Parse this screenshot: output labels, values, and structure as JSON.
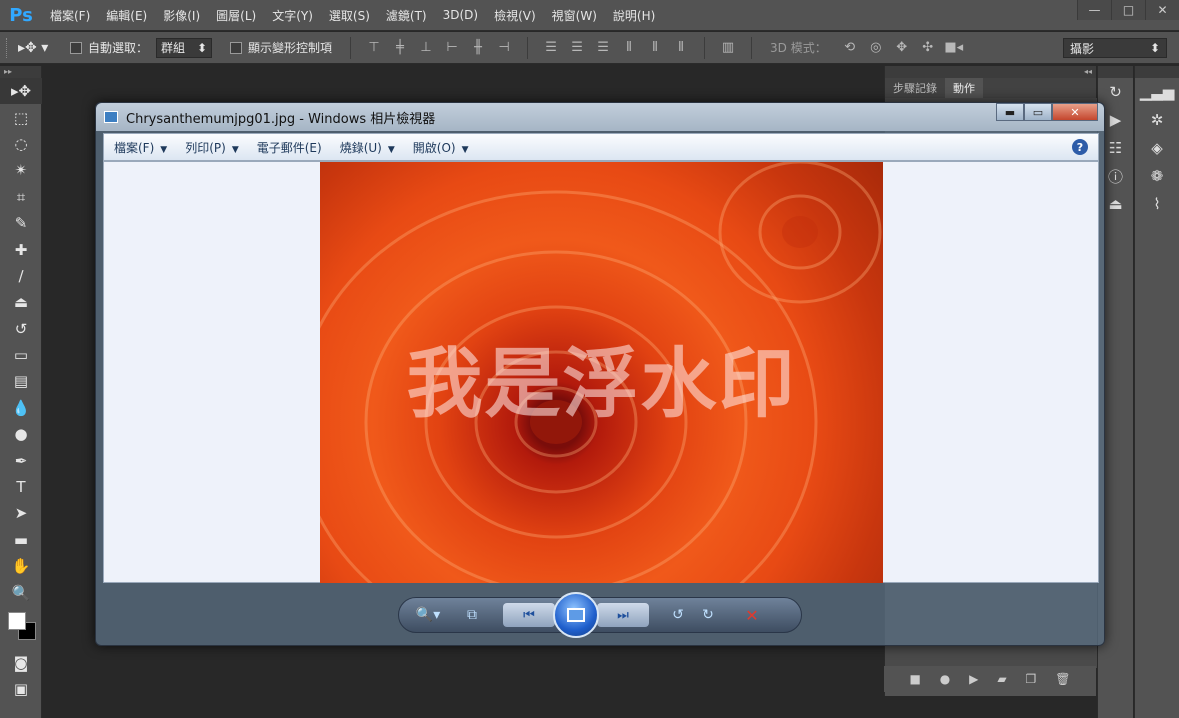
{
  "app": {
    "logo": "Ps",
    "menu": [
      "檔案(F)",
      "編輯(E)",
      "影像(I)",
      "圖層(L)",
      "文字(Y)",
      "選取(S)",
      "濾鏡(T)",
      "3D(D)",
      "檢視(V)",
      "視窗(W)",
      "說明(H)"
    ],
    "window_controls": [
      "—",
      "□",
      "✕"
    ]
  },
  "options_bar": {
    "tool_icon": "move-tool-icon",
    "auto_select_label": "自動選取：",
    "auto_select_value": "群組",
    "show_transform_label": "顯示變形控制項",
    "mode_3d_label": "3D 模式：",
    "workspace_value": "攝影"
  },
  "panels": {
    "tabs": [
      "步驟記錄",
      "動作"
    ],
    "active_tab": "動作"
  },
  "viewer": {
    "title": "Chrysanthemumjpg01.jpg - Windows 相片檢視器",
    "menu": [
      {
        "label": "檔案(F)",
        "has_arrow": true
      },
      {
        "label": "列印(P)",
        "has_arrow": true
      },
      {
        "label": "電子郵件(E)",
        "has_arrow": false
      },
      {
        "label": "燒錄(U)",
        "has_arrow": true
      },
      {
        "label": "開啟(O)",
        "has_arrow": true
      }
    ],
    "help": "?",
    "watermark": "我是浮水印",
    "controls": {
      "minimize": "▬",
      "maximize": "▭",
      "close": "✕"
    }
  },
  "colors": {
    "ps_accent": "#31a8ff",
    "flower_orange": "#f0591a",
    "viewer_close": "#c4462d"
  }
}
